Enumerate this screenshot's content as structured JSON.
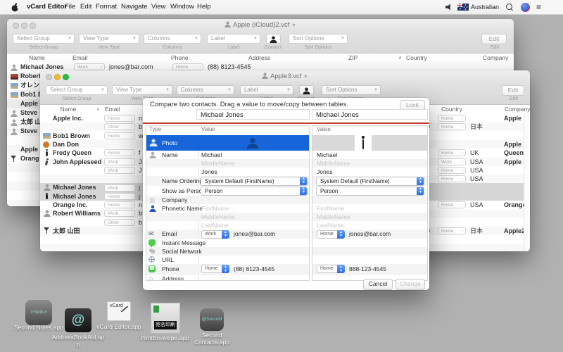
{
  "menubar": {
    "items": [
      "vCard Editor",
      "File",
      "Edit",
      "Format",
      "Navigate",
      "View",
      "Window",
      "Help"
    ],
    "input_region": "Australian"
  },
  "toolbar": {
    "select_group": "Select Group",
    "view_type": "View Type",
    "columns": "Columns",
    "label": "Label",
    "contact": "Contact",
    "sort_options": "Sort Options",
    "edit": "Edit"
  },
  "w1": {
    "title": "Apple (iCloud)2.vcf",
    "cols": [
      "Name",
      "Email",
      "Phone",
      "Address",
      "ZIP",
      "Country",
      "Company"
    ],
    "row1": {
      "name": "Michael Jones",
      "email_label": "Work",
      "email": "jones@bar.com",
      "phone_label": "Home",
      "phone": "(88) 8123-4545"
    },
    "row2": {
      "name": "Robert"
    },
    "list": [
      "オレンジ",
      "Bob1 B",
      "Apple",
      "Steve",
      "太郎 山",
      "Steve",
      "Apple",
      "Orang"
    ]
  },
  "w2": {
    "title": "Apple3.vcf",
    "col_name": "Name",
    "col_email": "Email",
    "col_country": "Country",
    "col_company": "Company",
    "rows": [
      {
        "name": "Apple Inc.",
        "email_label": "Home",
        "email": "n",
        "zip": "",
        "country_label": "Home",
        "country": "",
        "company": "Apple Inc."
      },
      {
        "name": "",
        "email_label": "Other",
        "email": "b",
        "zip": "0",
        "country_label": "Home",
        "country": "日本",
        "company": ""
      },
      {
        "name": "Bob1 Brown",
        "email_label": "Home",
        "email": "w",
        "zip": "",
        "country": "",
        "company": ""
      },
      {
        "name": "Dan Don",
        "email": "",
        "zip": "",
        "country": "",
        "company": "Apple"
      },
      {
        "name": "Fredy Queen",
        "email_label": "Home",
        "email": "f",
        "zip": "",
        "country_label": "Home",
        "country": "UK",
        "company": "Queen"
      },
      {
        "name": "John Appleseed",
        "email_label": "Work",
        "email": "J",
        "zip": "",
        "country_label": "Work",
        "country": "USA",
        "company": "Apple"
      },
      {
        "name": "",
        "email_label": "Work",
        "email": "J",
        "zip": "",
        "country_label": "Home",
        "country": "USA",
        "company": ""
      },
      {
        "name": "",
        "email": "",
        "zip": "",
        "country_label": "Home",
        "country": "USA",
        "company": ""
      },
      {
        "name": "Michael Jones",
        "email_label": "Work",
        "email": "j",
        "zip": "",
        "country": "",
        "company": "",
        "selected": true
      },
      {
        "name": "Michael Jones",
        "email_label": "Home",
        "email": "j",
        "zip": "",
        "country": "",
        "company": "",
        "selected": true
      },
      {
        "name": "Orange Inc.",
        "email_label": "Home",
        "email": "n",
        "zip": "",
        "country_label": "Home",
        "country": "USA",
        "company": "Orange Inc."
      },
      {
        "name": "Robert Williams",
        "email_label": "Work",
        "email": "b",
        "zip": "",
        "country": "",
        "company": ""
      },
      {
        "name": "",
        "email_label": "Other",
        "email": "b",
        "zip": "",
        "country": "",
        "company": ""
      },
      {
        "name": "太郎 山田",
        "email": "",
        "zip": "0",
        "country_label": "Home",
        "country": "日本",
        "company": "Apple2"
      }
    ]
  },
  "dialog": {
    "message": "Compare two contacts. Drag a value to move/copy between tables.",
    "lock": "Lock",
    "left_contact": "Michael Jones",
    "right_contact": "Michael Jones",
    "col_type": "Type",
    "col_value": "Value",
    "types": {
      "photo": "Photo",
      "name": "Name",
      "name_ordering": "Name Ordering",
      "show_as": "Show as Person",
      "company": "Company",
      "phonetic": "Phonetic Name",
      "email": "Email",
      "im": "Instant Message",
      "social": "Social Network",
      "url": "URL",
      "phone": "Phone",
      "address": "Address"
    },
    "left": {
      "first": "Michael",
      "middle_ph": "MiddleName",
      "last": "Jones",
      "ordering": "System Default (FirstName)",
      "show_as": "Person",
      "ph_first": "FirstName",
      "ph_middle": "MiddleName",
      "ph_last": "LastName",
      "email_label": "Work",
      "email": "jones@bar.com",
      "phone_label": "Home",
      "phone": "(88) 8123-4545"
    },
    "right": {
      "first": "Michael",
      "middle_ph": "MiddleName",
      "last": "Jones",
      "ordering": "System Default (FirstName)",
      "show_as": "Person",
      "ph_first": "FirstName",
      "ph_middle": "MiddleName",
      "ph_last": "LastName",
      "email_label": "Home",
      "email": "jones@bar.com",
      "phone_label": "Home",
      "phone": "888-123-4545"
    },
    "cancel": "Cancel",
    "change": "Change"
  },
  "desktop": {
    "icons": [
      {
        "label": "Second Notes.app",
        "badge": "# Note #"
      },
      {
        "label": "AddressBookAid.app",
        "badge": "@"
      },
      {
        "label": "vCard Editor.app",
        "badge": "vCard"
      },
      {
        "label": "PrintEnvelope.app",
        "badge": "宛名印刷"
      },
      {
        "label": "Second Contacts.app",
        "badge": "@Second"
      }
    ]
  }
}
